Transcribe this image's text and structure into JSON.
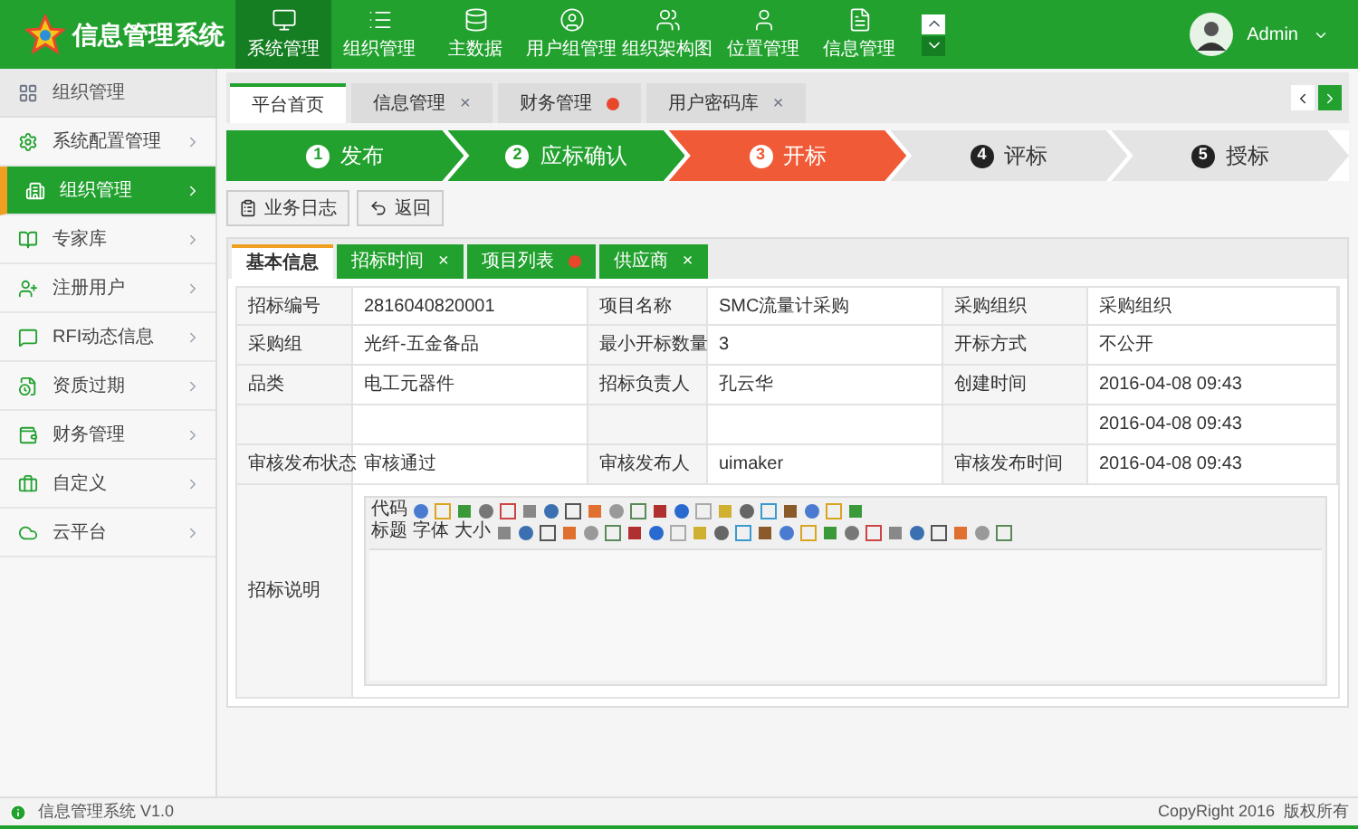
{
  "app": {
    "title": "信息管理系统"
  },
  "nav": [
    {
      "label": "系统管理",
      "selected": true
    },
    {
      "label": "组织管理",
      "selected": false
    },
    {
      "label": "主数据",
      "selected": false
    },
    {
      "label": "用户组管理",
      "selected": false
    },
    {
      "label": "组织架构图",
      "selected": false
    },
    {
      "label": "位置管理",
      "selected": false
    },
    {
      "label": "信息管理",
      "selected": false
    }
  ],
  "user": {
    "name": "Admin"
  },
  "sidebar": {
    "title": "组织管理",
    "items": [
      {
        "label": "系统配置管理",
        "selected": false
      },
      {
        "label": "组织管理",
        "selected": true
      },
      {
        "label": "专家库",
        "selected": false
      },
      {
        "label": "注册用户",
        "selected": false
      },
      {
        "label": "RFI动态信息",
        "selected": false
      },
      {
        "label": "资质过期",
        "selected": false
      },
      {
        "label": "财务管理",
        "selected": false
      },
      {
        "label": "自定义",
        "selected": false
      },
      {
        "label": "云平台",
        "selected": false
      }
    ]
  },
  "page_tabs": [
    {
      "label": "平台首页",
      "selected": true
    },
    {
      "label": "信息管理",
      "selected": false,
      "close": "×"
    },
    {
      "label": "财务管理",
      "selected": false,
      "close_dot": true
    },
    {
      "label": "用户密码库",
      "selected": false,
      "close": "×"
    }
  ],
  "steps": [
    {
      "number": "1",
      "label": "发布",
      "kind": "done"
    },
    {
      "number": "2",
      "label": "应标确认",
      "kind": "done"
    },
    {
      "number": "3",
      "label": "开标",
      "kind": "current"
    },
    {
      "number": "4",
      "label": "评标",
      "kind": "todo"
    },
    {
      "number": "5",
      "label": "授标",
      "kind": "todo"
    }
  ],
  "actions": [
    "业务日志",
    "返回"
  ],
  "detail_tabs": [
    {
      "label": "基本信息",
      "selected": true
    },
    {
      "label": "招标时间",
      "selected": false,
      "close": "×"
    },
    {
      "label": "项目列表",
      "selected": false,
      "close_dot": true
    },
    {
      "label": "供应商",
      "selected": false,
      "close": "×"
    }
  ],
  "table": {
    "rows": [
      [
        {
          "label": "招标编号",
          "value": "2816040820001"
        },
        {
          "label": "项目名称",
          "value": "SMC流量计采购"
        },
        {
          "label": "采购组织",
          "value": "采购组织"
        }
      ],
      [
        {
          "label": "采购组",
          "value": "光纤-五金备品"
        },
        {
          "label": "最小开标数量",
          "value": "3"
        },
        {
          "label": "开标方式",
          "value": "不公开"
        }
      ],
      [
        {
          "label": "品类",
          "value": "电工元器件"
        },
        {
          "label": "招标负责人",
          "value": "孔云华"
        },
        {
          "label": "创建时间",
          "value": "2016-04-08 09:43"
        }
      ],
      [
        {},
        {},
        {
          "value": "2016-04-08 09:43"
        }
      ],
      [
        {
          "label": "审核发布状态",
          "value": "审核通过"
        },
        {
          "label": "审核发布人",
          "value": "uimaker"
        },
        {
          "label": "审核发布时间",
          "value": "2016-04-08 09:43"
        }
      ]
    ],
    "editor": {
      "label": "招标说明",
      "toolbar_labels": [
        "代码",
        "标题",
        "字体",
        "大小"
      ]
    }
  },
  "status_bar": {
    "left": "信息管理系统 V1.0",
    "right": "CopyRight 2016  版权所有"
  }
}
